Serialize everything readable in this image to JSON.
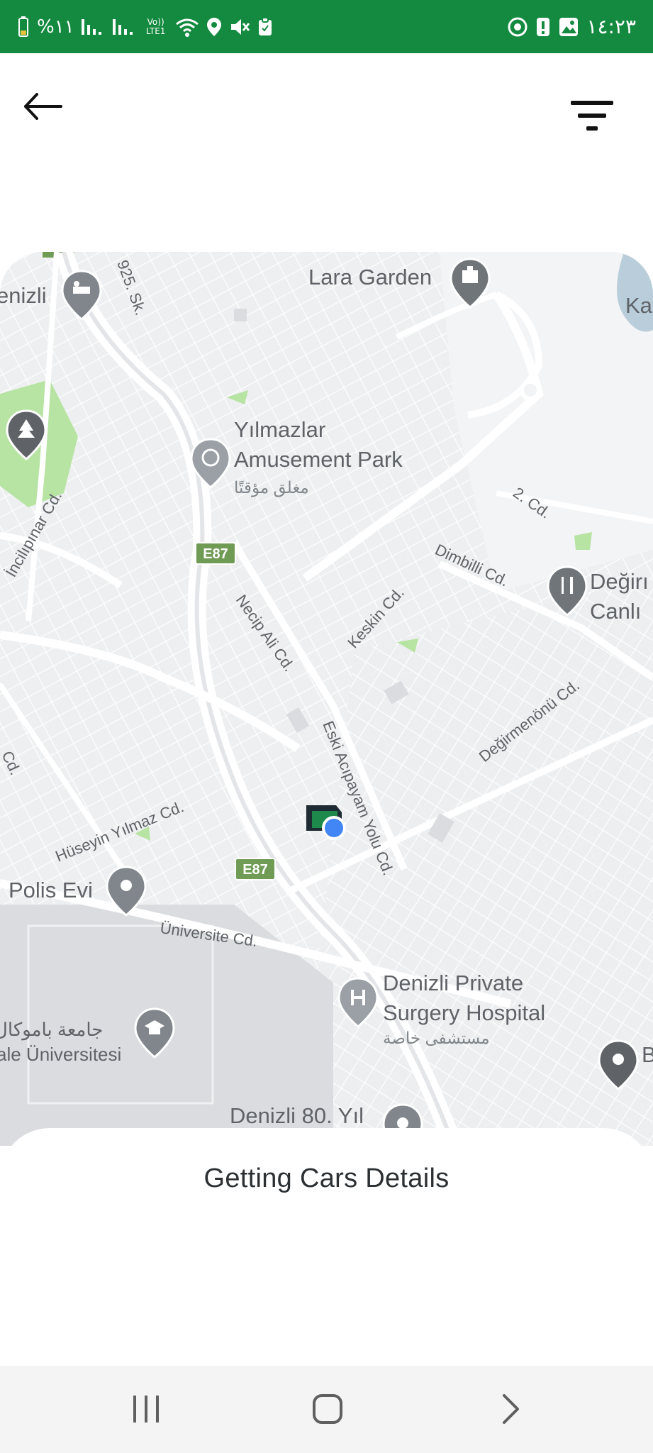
{
  "status_bar": {
    "left_text": "%١١",
    "volte_label": "Vo)) LTE1",
    "time": "١٤:٢٣"
  },
  "header": {
    "back_icon": "arrow-left-icon",
    "filter_icon": "filter-icon"
  },
  "map": {
    "labels": {
      "lara_garden": "Lara Garden",
      "denizli_partial": "enizli",
      "sk_925": "925. Sk.",
      "ka_partial": "Ka",
      "ylmazlar_1": "Yılmazlar",
      "ylmazlar_2": "Amusement Park",
      "closed_ar": "مغلق مؤقتًا",
      "incilipinar": "İncilıpınar Cd.",
      "e87_1": "E87",
      "e87_2": "E87",
      "cd_2": "2. Cd.",
      "dimbilli": "Dimbilli Cd.",
      "degir_1": "Değirı",
      "degir_2": "Canlı",
      "necip_ali": "Necip Ali Cd.",
      "keskin": "Keskin Cd.",
      "degirmenonu": "Değirmenönü Cd.",
      "eski_acipayam": "Eski Acıpayam Yolu Cd.",
      "cd_left": "Cd.",
      "huseyin_yilmaz": "Hüseyin Yılmaz Cd.",
      "polis_evi": "Polis Evi",
      "universite": "Üniversite Cd.",
      "denizli_private_1": "Denizli Private",
      "denizli_private_2": "Surgery Hospital",
      "private_hospital_ar": "مستشفى خاصة",
      "university_ar": "جامعة باموكال",
      "university_tr": "ale Üniversitesi",
      "denizli_80": "Denizli 80. Yıl",
      "b_partial": "B"
    },
    "pins": {
      "hotel": "hotel-icon",
      "landmark": "landmark-icon",
      "park": "park-icon",
      "amusement": "amusement-park-icon",
      "restaurant": "restaurant-icon",
      "polis": "map-pin-icon",
      "hospital": "hospital-icon",
      "university": "graduation-cap-icon",
      "denizli80": "map-pin-icon",
      "b_pin": "map-pin-icon"
    }
  },
  "sheet": {
    "title": "Getting Cars Details"
  },
  "nav": {
    "recents": "recents-icon",
    "home": "home-icon",
    "back": "back-chevron-icon"
  },
  "colors": {
    "status_bar": "#138a3f",
    "map_bg": "#f1f3f4",
    "road": "#ffffff",
    "park": "#b7e3a3",
    "campus": "#dadcdf",
    "pin": "#70757a",
    "location_dot": "#4285f4",
    "highway_badge": "#6f9b55"
  }
}
